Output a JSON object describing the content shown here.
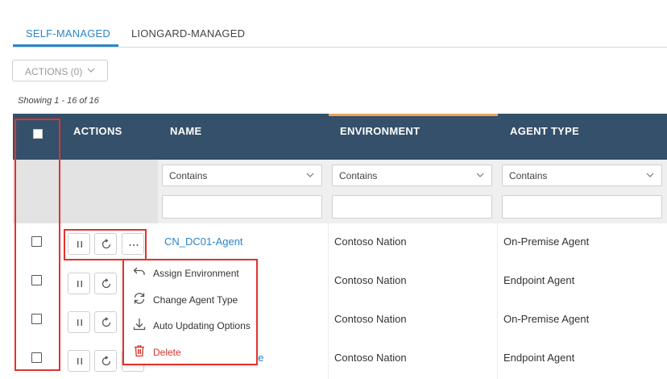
{
  "tabs": [
    {
      "label": "SELF-MANAGED",
      "active": true
    },
    {
      "label": "LIONGARD-MANAGED",
      "active": false
    }
  ],
  "toolbar": {
    "actions_label": "ACTIONS (0)",
    "showing_text": "Showing 1 - 16 of 16"
  },
  "table": {
    "headers": [
      "ACTIONS",
      "NAME",
      "ENVIRONMENT",
      "AGENT TYPE"
    ],
    "filters": {
      "name": {
        "operator": "Contains",
        "value": ""
      },
      "environment": {
        "operator": "Contains",
        "value": ""
      },
      "agent_type": {
        "operator": "Contains",
        "value": ""
      }
    },
    "rows": [
      {
        "name": "CN_DC01-Agent",
        "environment": "Contoso Nation",
        "agent_type": "On-Premise Agent"
      },
      {
        "name": "",
        "environment": "Contoso Nation",
        "agent_type": "Endpoint Agent"
      },
      {
        "name": "",
        "environment": "Contoso Nation",
        "agent_type": "On-Premise Agent"
      },
      {
        "name": "ne",
        "environment": "Contoso Nation",
        "agent_type": "Endpoint Agent"
      }
    ]
  },
  "context_menu": {
    "items": [
      {
        "label": "Assign Environment",
        "icon": "undo-arrow-icon"
      },
      {
        "label": "Change Agent Type",
        "icon": "refresh-cycle-icon"
      },
      {
        "label": "Auto Updating Options",
        "icon": "download-icon"
      },
      {
        "label": "Delete",
        "icon": "trash-icon"
      }
    ]
  },
  "colors": {
    "accent": "#2a86c9",
    "header_bg": "#34506a",
    "highlight": "#e0332f",
    "env_accent": "#f0a35a",
    "danger": "#d9342b"
  }
}
